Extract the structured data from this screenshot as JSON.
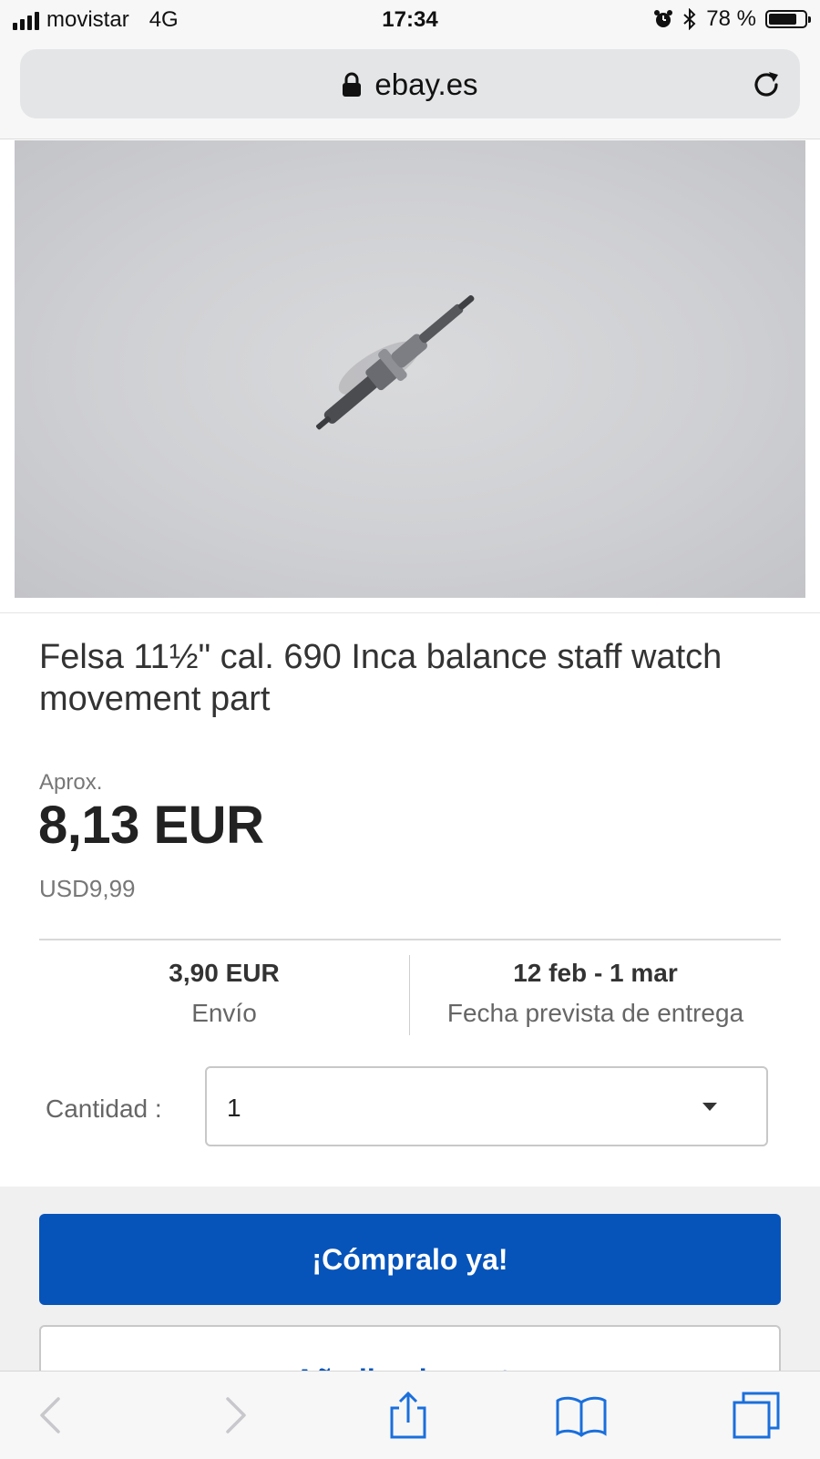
{
  "status_bar": {
    "carrier": "movistar",
    "network": "4G",
    "time": "17:34",
    "battery": "78 %",
    "battery_level": 0.78
  },
  "browser": {
    "url": "ebay.es",
    "icons": [
      "lock-icon",
      "reload-icon"
    ]
  },
  "product": {
    "title": "Felsa 11½\" cal. 690 Inca balance staff watch movement part",
    "approx_label": "Aprox.",
    "price": "8,13 EUR",
    "original_price": "USD9,99"
  },
  "shipping": {
    "cost": "3,90 EUR",
    "cost_label": "Envío",
    "delivery": "12 feb - 1 mar",
    "delivery_label": "Fecha prevista de entrega"
  },
  "quantity": {
    "label": "Cantidad :",
    "value": "1"
  },
  "actions": {
    "buy_now": "¡Cómpralo ya!",
    "add_to_cart": "Añadir a la cesta"
  },
  "toolbar": {
    "icons": [
      "back-icon",
      "forward-icon",
      "share-icon",
      "bookmarks-icon",
      "tabs-icon"
    ]
  },
  "colors": {
    "accent": "#0654ba",
    "background": "#ffffff",
    "band": "#f0f0f0"
  }
}
